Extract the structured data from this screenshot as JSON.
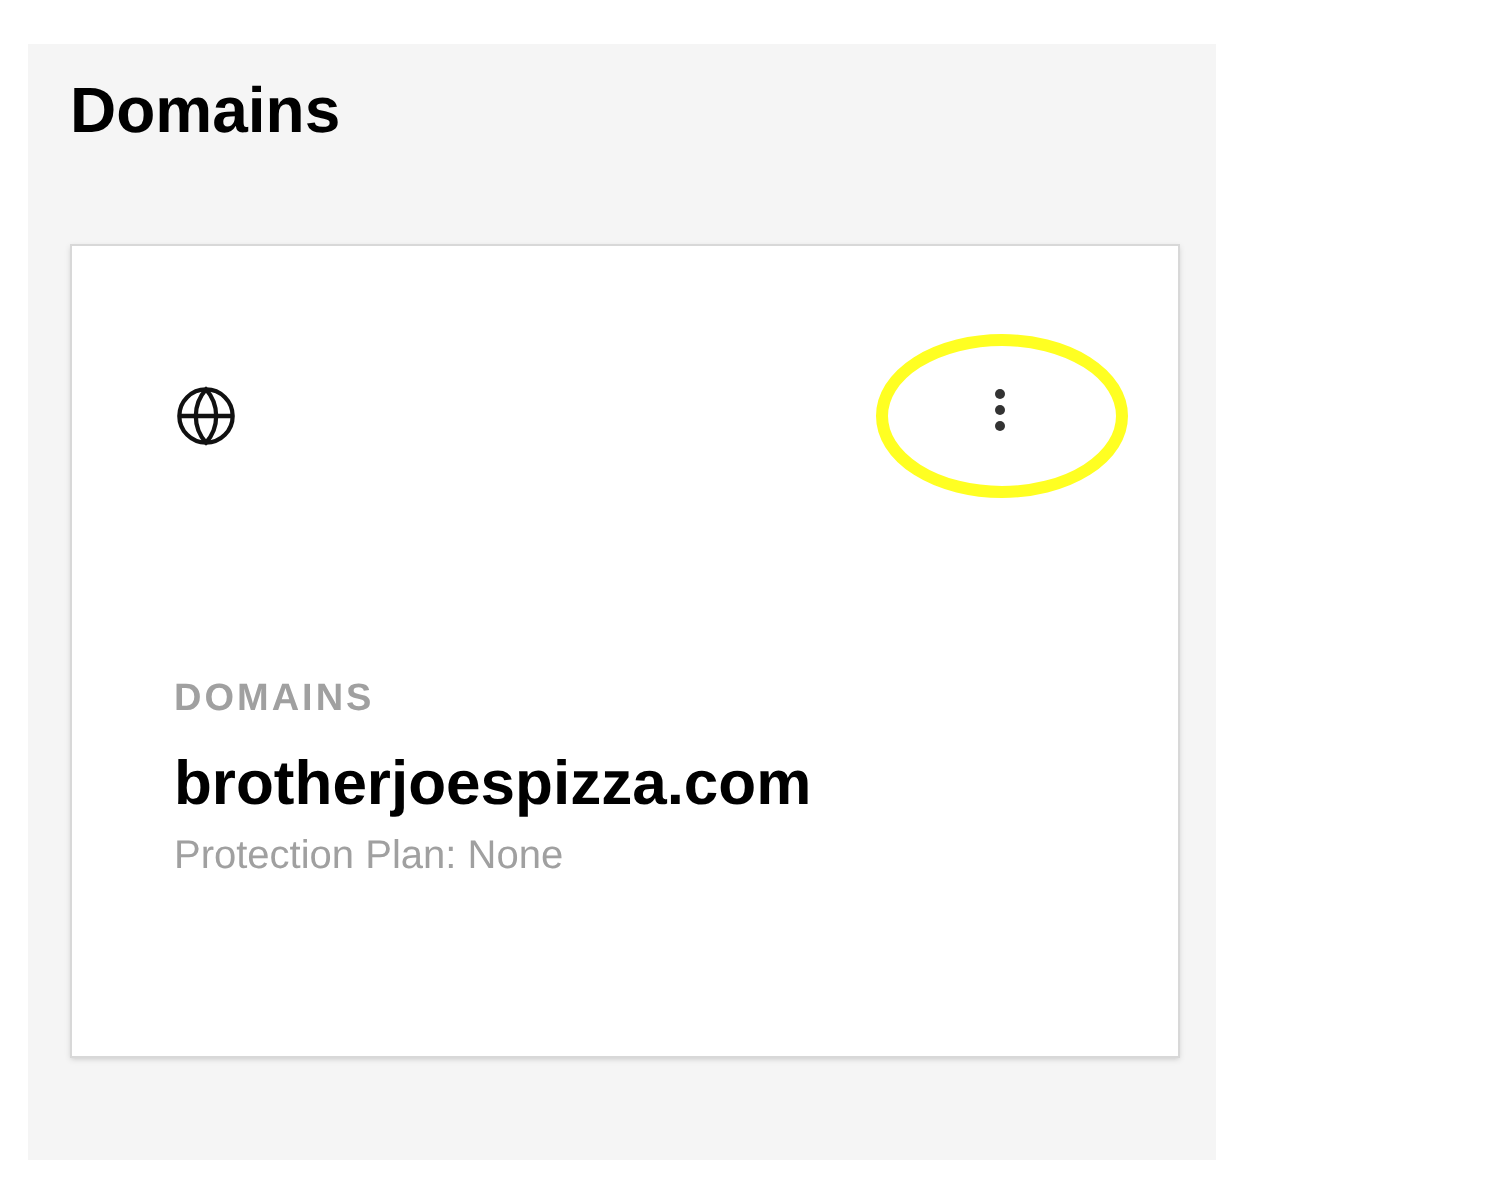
{
  "page": {
    "title": "Domains"
  },
  "card": {
    "category": "DOMAINS",
    "domain": "brotherjoespizza.com",
    "protection": "Protection Plan: None",
    "menu_highlighted": true
  }
}
